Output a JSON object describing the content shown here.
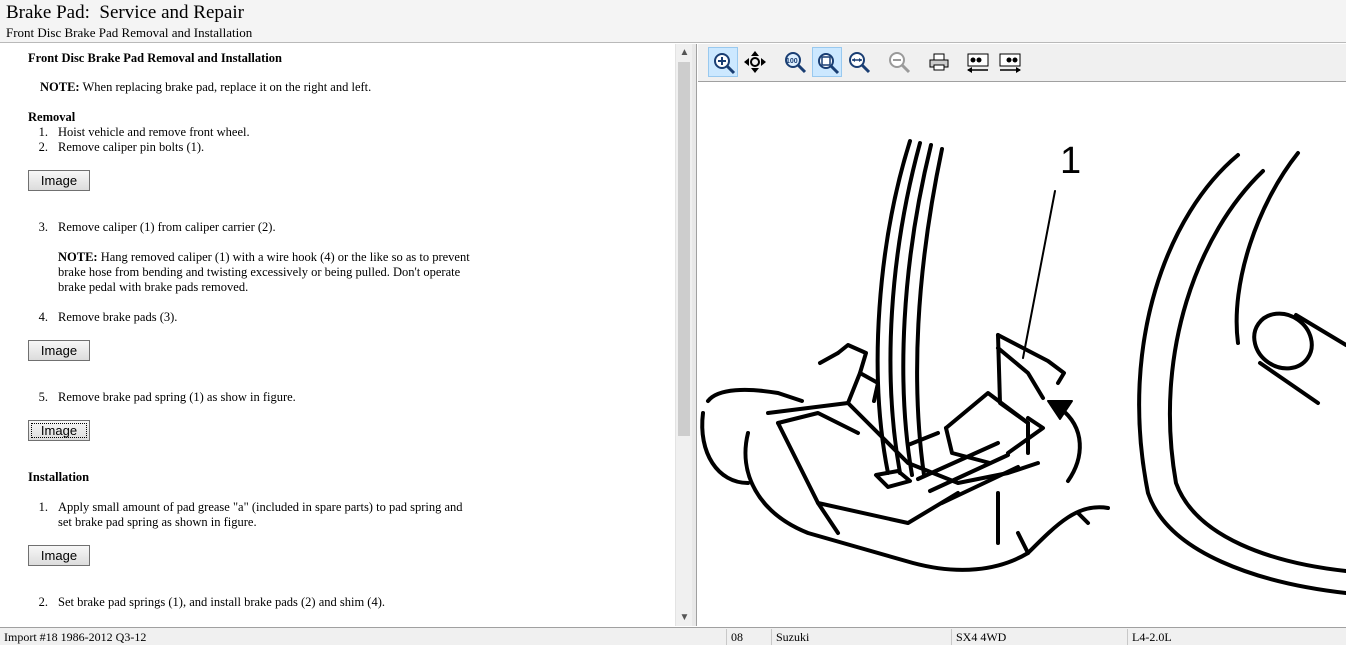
{
  "header": {
    "title": "Brake Pad:  Service and Repair",
    "subtitle": "Front Disc Brake Pad Removal and Installation"
  },
  "doc": {
    "heading": "Front Disc Brake Pad Removal and Installation",
    "note1_label": "NOTE:",
    "note1_text": " When replacing brake pad, replace it on the right and left.",
    "removal_heading": "Removal",
    "steps": [
      {
        "num": "1.",
        "text": "Hoist vehicle and remove front wheel."
      },
      {
        "num": "2.",
        "text": "Remove caliper pin bolts (1)."
      },
      {
        "num": "3.",
        "text": "Remove caliper (1) from caliper carrier (2)."
      },
      {
        "num": "4.",
        "text": "Remove brake pads (3)."
      },
      {
        "num": "5.",
        "text": "Remove brake pad spring (1) as show in figure."
      }
    ],
    "note2_label": "NOTE:",
    "note2_lines": [
      " Hang removed caliper (1) with a wire hook (4) or the like so as to prevent",
      "brake hose from bending and twisting excessively or being pulled. Don't operate",
      "brake pedal with brake pads removed."
    ],
    "installation_heading": "Installation",
    "install_steps": [
      {
        "num": "1.",
        "lines": [
          "Apply small amount of pad grease \"a\" (included in spare parts) to pad spring and",
          "set brake pad spring as shown in figure."
        ]
      },
      {
        "num": "2.",
        "lines": [
          "Set brake pad springs (1), and install brake pads (2) and shim (4)."
        ]
      }
    ],
    "image_button_label": "Image"
  },
  "toolbar": {
    "icons": [
      "zoom-in-icon",
      "pan-icon",
      "zoom-100-icon",
      "zoom-fit-icon",
      "zoom-width-icon",
      "zoom-out-icon",
      "print-icon",
      "previous-image-icon",
      "next-image-icon"
    ]
  },
  "figure": {
    "callout_label": "1"
  },
  "status": {
    "import": "Import #18 1986-2012 Q3-12",
    "code": "08",
    "make": "Suzuki",
    "model": "SX4 4WD",
    "engine": "L4-2.0L"
  },
  "colors": {
    "toolbar_active": "#cce8ff",
    "button_face": "#e1e1e1"
  }
}
